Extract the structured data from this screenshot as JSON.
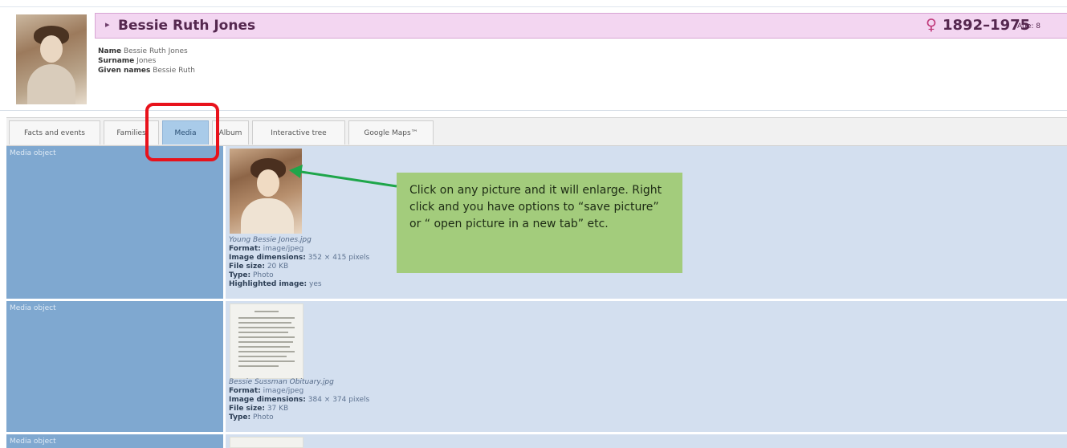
{
  "person": {
    "name": "Bessie Ruth Jones",
    "years": "1892–1975",
    "age_label": "Age: 8",
    "facts": [
      {
        "label": "Name",
        "value": "Bessie Ruth Jones"
      },
      {
        "label": "Surname",
        "value": "Jones"
      },
      {
        "label": "Given names",
        "value": "Bessie Ruth"
      }
    ]
  },
  "tabs": [
    {
      "label": "Facts and events",
      "active": false
    },
    {
      "label": "Families",
      "active": false
    },
    {
      "label": "Media",
      "active": true
    },
    {
      "label": "Album",
      "active": false
    },
    {
      "label": "Interactive tree",
      "active": false
    },
    {
      "label": "Google Maps™",
      "active": false
    }
  ],
  "media_rows": [
    {
      "label": "Media object",
      "filename": "Young Bessie Jones.jpg",
      "format_label": "Format:",
      "format": "image/jpeg",
      "dims_label": "Image dimensions:",
      "dims": "352 × 415 pixels",
      "size_label": "File size:",
      "size": "20 KB",
      "type_label": "Type:",
      "type": "Photo",
      "highlight_label": "Highlighted image:",
      "highlight": "yes"
    },
    {
      "label": "Media object",
      "filename": "Bessie Sussman Obituary.jpg",
      "format_label": "Format:",
      "format": "image/jpeg",
      "dims_label": "Image dimensions:",
      "dims": "384 × 374 pixels",
      "size_label": "File size:",
      "size": "37 KB",
      "type_label": "Type:",
      "type": "Photo"
    },
    {
      "label": "Media object"
    }
  ],
  "callout": {
    "text": "Click on any picture and it will enlarge.  Right click and you have options to “save picture” or “ open picture in a new tab” etc."
  },
  "colors": {
    "namebar_bg": "#f3d6f1",
    "tab_active": "#a9cbe9",
    "media_label_col": "#7fa8d0",
    "media_content_col": "#d3dfef",
    "highlight_box": "#e8121b",
    "arrow": "#1ea64a",
    "callout_bg": "#a3cc7c"
  }
}
